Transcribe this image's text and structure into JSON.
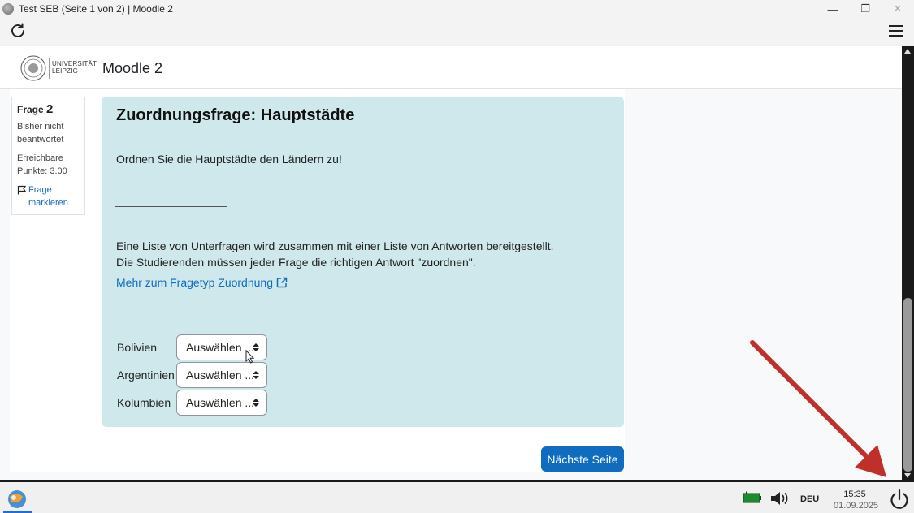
{
  "window": {
    "title": "Test SEB (Seite 1 von 2) | Moodle 2",
    "minimize": "—",
    "restore": "❐",
    "close": "✕"
  },
  "header": {
    "logo_line1": "UNIVERSITÄT",
    "logo_line2": "LEIPZIG",
    "site_name": "Moodle 2"
  },
  "nav": {
    "question_label": "Frage",
    "question_number": "2",
    "state": "Bisher nicht beantwortet",
    "grade": "Erreichbare Punkte: 3.00",
    "flag": "Frage markieren"
  },
  "question": {
    "title": "Zuordnungsfrage: Hauptstädte",
    "text": "Ordnen Sie die Hauptstädte den Ländern zu!",
    "description": "Eine Liste von Unterfragen wird zusammen mit einer Liste von Antworten bereitgestellt. Die Studierenden müssen jeder Frage die richtigen Antwort \"zuordnen\".",
    "link": "Mehr zum Fragetyp Zuordnung",
    "rows": [
      {
        "label": "Bolivien",
        "selected": "Auswählen ..."
      },
      {
        "label": "Argentinien",
        "selected": "Auswählen ..."
      },
      {
        "label": "Kolumbien",
        "selected": "Auswählen ..."
      }
    ]
  },
  "next_button": "Nächste Seite",
  "taskbar": {
    "language": "DEU",
    "time": "15:35",
    "date": "01.09.2025"
  },
  "colors": {
    "accent": "#0f6cbf",
    "question_bg": "#cfe8eb",
    "annotation_arrow": "#c0302b"
  }
}
